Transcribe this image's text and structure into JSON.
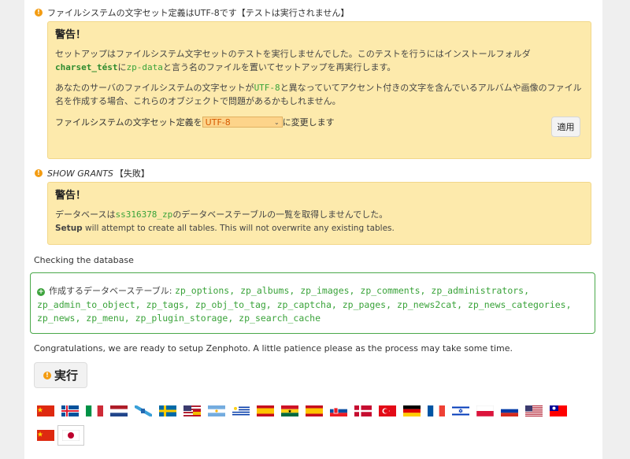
{
  "charset_check": {
    "title": "ファイルシステムの文字セット定義はUTF-8です【テストは実行されません】",
    "warning_heading": "警告！",
    "p1_a": "セットアップはファイルシステム文字セットのテストを実行しませんでした。このテストを行うにはインストールフォルダ",
    "p1_folder": "charset_tést",
    "p1_b": "に",
    "p1_file": "zp-data",
    "p1_c": "と言う名のファイルを置いてセットアップを再実行します。",
    "p2_a": "あなたのサーバのファイルシステムの文字セットが",
    "p2_charset": "UTF-8",
    "p2_b": "と異なっていてアクセント付きの文字を含んでいるアルバムや画像のファイル名を作成する場合、これらのオブジェクトで問題があるかもしれません。",
    "define_label_a": "ファイルシステムの文字セット定義を",
    "select_value": "UTF-8",
    "define_label_b": "に変更します",
    "apply_button": "適用"
  },
  "grants_check": {
    "title_a": "SHOW GRANTS",
    "title_b": "【失敗】",
    "warning_heading": "警告！",
    "p1_a": "データベースは",
    "p1_db": "ss316378_zp",
    "p1_b": "のデータベーステーブルの一覧を取得しませんでした。",
    "p2_bold": "Setup",
    "p2_rest": " will attempt to create all tables. This will not overwrite any existing tables."
  },
  "checking_label": "Checking the database",
  "tables": {
    "label": "作成するデータベーステーブル: ",
    "list": "zp_options, zp_albums, zp_images, zp_comments, zp_administrators, zp_admin_to_object, zp_tags, zp_obj_to_tag, zp_captcha, zp_pages, zp_news2cat, zp_news_categories, zp_news, zp_menu, zp_plugin_storage, zp_search_cache"
  },
  "congrats": "Congratulations, we are ready to setup Zenphoto. A little patience please as the process may take some time.",
  "run_button": "実行",
  "colors": {
    "warning_bg": "#fdeaac",
    "ok_green": "#4aa84a",
    "code_green": "#3aa33a"
  }
}
